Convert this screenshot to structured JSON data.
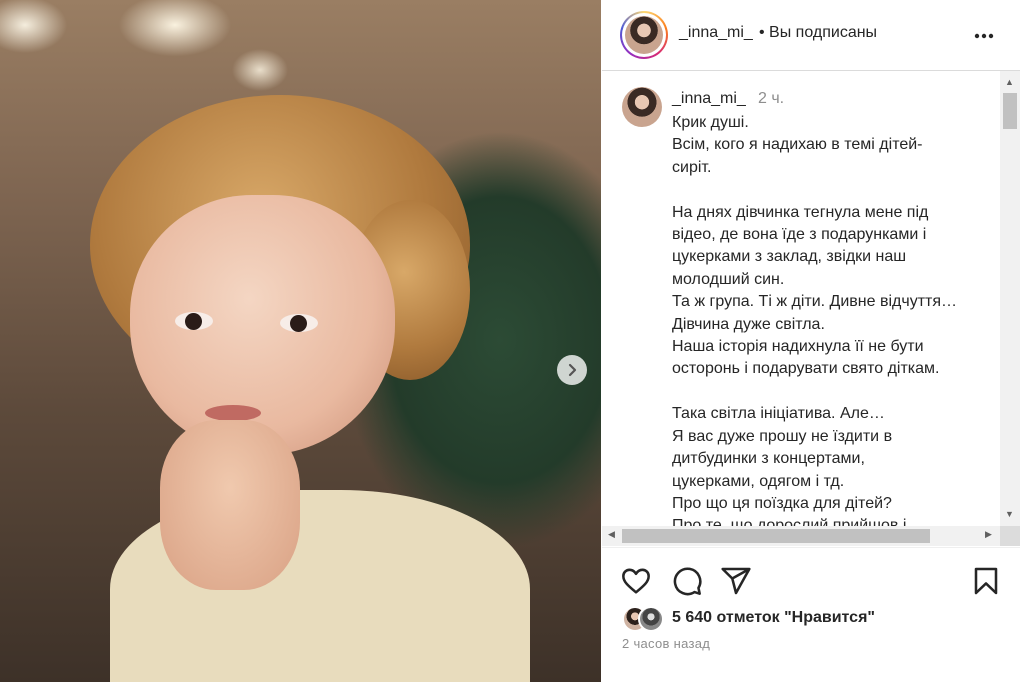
{
  "post": {
    "username": "_inna_mi_",
    "following_status": "• Вы подписаны",
    "more_label": "•••"
  },
  "caption": {
    "username": "_inna_mi_",
    "time": "2 ч.",
    "text": "Крик душі.\nВсім, кого я надихаю в темі дітей-\nсиріт.\n\nНа днях дівчинка тегнула мене під\nвідео, де вона їде з подарунками і\nцукерками з заклад, звідки наш\nмолодший син.\nТа ж група. Ті ж діти. Дивне відчуття…\nДівчина дуже світла.\nНаша історія надихнула її не бути\nосторонь і подарувати свято діткам.\n\nТака світла ініціатива. Але…\nЯ вас дуже прошу не їздити в\nдитбудинки з концертами,\nцукерками, одягом і тд.\nПро що ця поїздка для дітей?\nПро те, що дорослий прийшов і"
  },
  "actions": {
    "icons": [
      "heart-icon",
      "comment-icon",
      "share-icon",
      "bookmark-icon"
    ]
  },
  "likes": {
    "text": "5 640 отметок \"Нравится\""
  },
  "timestamp": "2 часов назад",
  "colors": {
    "text": "#262626",
    "muted": "#8e8e8e",
    "border": "#dbdbdb"
  }
}
